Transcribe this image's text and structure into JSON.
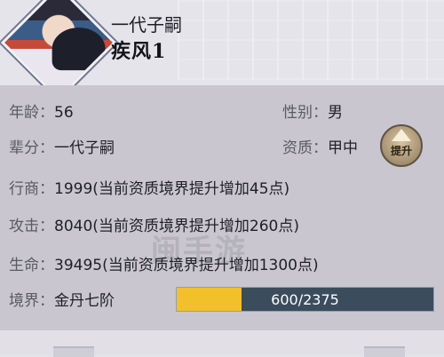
{
  "header": {
    "name_title": "一代子嗣",
    "name_sub": "疾风1"
  },
  "stats": {
    "age_label": "年龄：",
    "age_value": "56",
    "gender_label": "性别：",
    "gender_value": "男",
    "generation_label": "辈分：",
    "generation_value": "一代子嗣",
    "aptitude_label": "资质：",
    "aptitude_value": "甲中",
    "commerce_label": "行商：",
    "commerce_value": "1999(当前资质境界提升增加45点)",
    "attack_label": "攻击：",
    "attack_value": "8040(当前资质境界提升增加260点)",
    "hp_label": "生命：",
    "hp_value": "39495(当前资质境界提升增加1300点)",
    "realm_label": "境界：",
    "realm_value": "金丹七阶"
  },
  "upgrade_button": {
    "label": "提升",
    "icon": "up-arrow-icon"
  },
  "realm_progress": {
    "current": 600,
    "max": 2375,
    "text": "600/2375"
  },
  "colors": {
    "progress_fill": "#f2c12a",
    "progress_track": "#3b4c5c"
  }
}
